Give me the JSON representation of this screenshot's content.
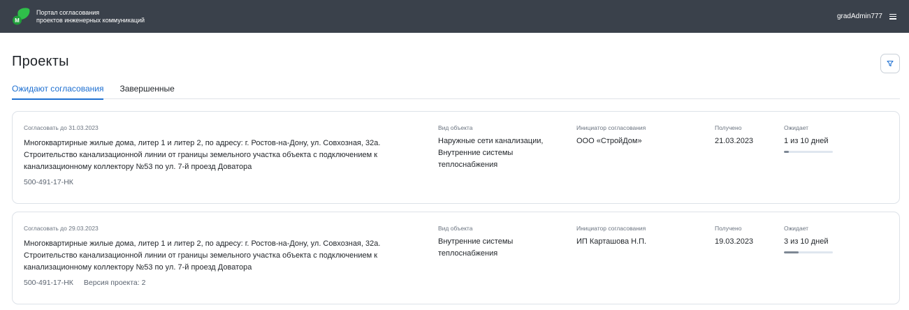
{
  "header": {
    "app_title_line1": "Портал согласования",
    "app_title_line2": "проектов инженерных коммуникаций",
    "username": "gradAdmin777",
    "logo_letter": "M"
  },
  "page": {
    "title": "Проекты",
    "tabs": [
      {
        "label": "Ожидают согласования",
        "active": true
      },
      {
        "label": "Завершенные",
        "active": false
      }
    ]
  },
  "projects": [
    {
      "deadline": "Согласовать до 31.03.2023",
      "description": "Многоквартирные жилые дома, литер 1 и литер 2, по адресу: г. Ростов-на-Дону, ул. Совхозная, 32а. Строительство канализационной линии от границы земельного участка объекта с подключением к канализационному коллектору №53 по ул. 7-й проезд Доватора",
      "code": "500-491-17-НК",
      "version": "",
      "object_kind_label": "Вид объекта",
      "object_kind": "Наружные сети канализации, Внутренние системы теплоснабжения",
      "initiator_label": "Инициатор согласования",
      "initiator": "ООО «СтройДом»",
      "received_label": "Получено",
      "received": "21.03.2023",
      "waiting_label": "Ожидает",
      "waiting": "1 из 10 дней",
      "waiting_progress": 0.1
    },
    {
      "deadline": "Согласовать до 29.03.2023",
      "description": "Многоквартирные жилые дома, литер 1 и литер 2, по адресу: г. Ростов-на-Дону, ул. Совхозная, 32а. Строительство канализационной линии от границы земельного участка объекта с подключением к канализационному коллектору №53 по ул. 7-й проезд Доватора",
      "code": "500-491-17-НК",
      "version": "Версия проекта: 2",
      "object_kind_label": "Вид объекта",
      "object_kind": "Внутренние системы теплоснабжения",
      "initiator_label": "Инициатор согласования",
      "initiator": "ИП Карташова Н.П.",
      "received_label": "Получено",
      "received": "19.03.2023",
      "waiting_label": "Ожидает",
      "waiting": "3 из 10 дней",
      "waiting_progress": 0.3
    }
  ],
  "colors": {
    "topbar": "#3a414b",
    "accent": "#1d6fd1",
    "logo_green": "#2fbf4a"
  },
  "icons": {
    "logo": "portal-logo-icon",
    "menu": "hamburger-menu-icon",
    "filter": "filter-funnel-icon"
  }
}
